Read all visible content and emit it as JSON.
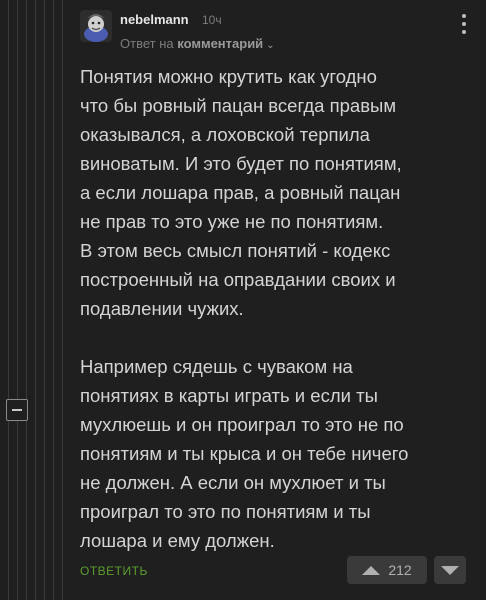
{
  "comment": {
    "username": "nebelmann",
    "time": "10ч",
    "reply_prefix": "Ответ на",
    "reply_target": "комментарий",
    "paragraph1_lines": [
      "Понятия можно крутить как угодно",
      "что бы ровный пацан всегда правым",
      "оказывался, а лоховской терпила",
      "виноватым. И это будет по понятиям,",
      "а если лошара прав, а ровный пацан",
      "не прав то это уже не по понятиям.",
      "В этом весь смысл понятий - кодекс",
      "построенный на оправдании своих и",
      "подавлении чужих."
    ],
    "paragraph2_lines": [
      "Например сядешь с чуваком на",
      "понятиях в карты играть и если ты",
      "мухлюешь и он проиграл то это не по",
      "понятиям и ты крыса и он тебе ничего",
      "не должен. А если он мухлюет и ты",
      "проиграл то это по понятиям и ты",
      "лошара и ему должен."
    ],
    "reply_label": "ОТВЕТИТЬ",
    "rating": "212"
  },
  "colors": {
    "background": "#1f1f1f",
    "text": "#d4d4d4",
    "reply_green": "#5c9e2e",
    "vote_bg": "#3a3a3a"
  }
}
